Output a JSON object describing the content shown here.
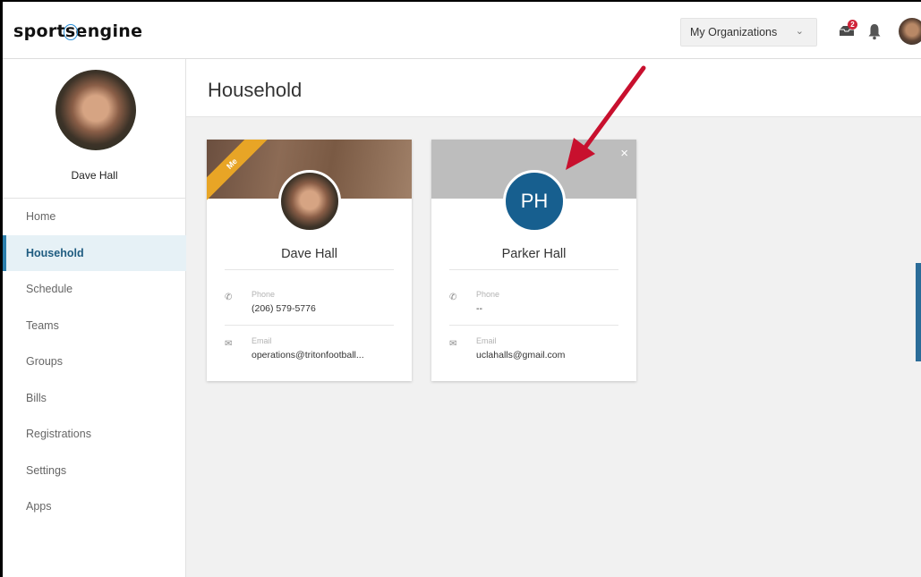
{
  "app": {
    "logo_text_a": "sport",
    "logo_text_b": "s",
    "logo_text_c": "engine"
  },
  "topbar": {
    "org_button": "My Organizations",
    "inbox_badge": "2",
    "icons": [
      "inbox-icon",
      "bell-icon",
      "user-avatar"
    ]
  },
  "sidebar": {
    "user_name": "Dave Hall",
    "items": [
      {
        "label": "Home"
      },
      {
        "label": "Household",
        "active": true
      },
      {
        "label": "Schedule"
      },
      {
        "label": "Teams"
      },
      {
        "label": "Groups"
      },
      {
        "label": "Bills"
      },
      {
        "label": "Registrations"
      },
      {
        "label": "Settings"
      },
      {
        "label": "Apps"
      }
    ]
  },
  "main": {
    "title": "Household",
    "members": [
      {
        "name": "Dave Hall",
        "ribbon": "Me",
        "phone_label": "Phone",
        "phone": "(206) 579-5776",
        "email_label": "Email",
        "email": "operations@tritonfootball..."
      },
      {
        "name": "Parker Hall",
        "initials": "PH",
        "close": "×",
        "phone_label": "Phone",
        "phone": "--",
        "email_label": "Email",
        "email": "uclahalls@gmail.com"
      }
    ]
  },
  "colors": {
    "accent": "#2b7fac",
    "initials_bg": "#175f8f",
    "ribbon": "#e8a526",
    "annotation_arrow": "#c8102e"
  }
}
